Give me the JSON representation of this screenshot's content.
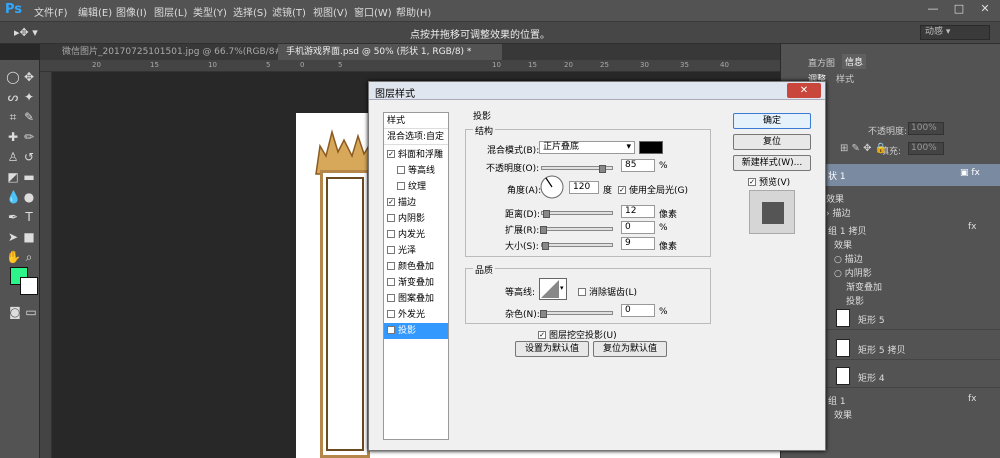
{
  "menubar": {
    "logo": "Ps",
    "items": [
      "文件(F)",
      "编辑(E)",
      "图像(I)",
      "图层(L)",
      "类型(Y)",
      "选择(S)",
      "滤镜(T)",
      "视图(V)",
      "窗口(W)",
      "帮助(H)"
    ]
  },
  "optionsbar": {
    "hint": "点按并拖移可调整效果的位置。",
    "workspace": "动感"
  },
  "tabs": [
    {
      "label": "微信图片_20170725101501.jpg @ 66.7%(RGB/8#) *"
    },
    {
      "label": "手机游戏界面.psd @ 50% (形状 1, RGB/8) *"
    }
  ],
  "ruler": {
    "labels": [
      "20",
      "15",
      "10",
      "5",
      "0",
      "5",
      "10",
      "15",
      "20",
      "25",
      "30",
      "35",
      "40"
    ]
  },
  "right_panel": {
    "tabs": [
      "直方图",
      "信息"
    ],
    "tab2": [
      "调整",
      "样式"
    ],
    "opacity_label": "不透明度:",
    "opacity_value": "100%",
    "fill_label": "填充:",
    "fill_value": "100%",
    "layers": [
      {
        "name": "状 1"
      },
      {
        "name": "效果"
      },
      {
        "name": "描边"
      },
      {
        "name": "组 1 拷贝"
      },
      {
        "name": "效果"
      },
      {
        "name": "描边"
      },
      {
        "name": "内阴影"
      },
      {
        "name": "渐变叠加"
      },
      {
        "name": "投影"
      },
      {
        "name": "矩形 5"
      },
      {
        "name": "矩形 5 拷贝"
      },
      {
        "name": "矩形 4"
      },
      {
        "name": "组 1"
      },
      {
        "name": "效果"
      }
    ]
  },
  "dialog": {
    "title": "图层样式",
    "close": "✕",
    "styles_header": "样式",
    "blend_options": "混合选项:自定",
    "styles": [
      {
        "label": "斜面和浮雕",
        "checked": true
      },
      {
        "label": "等高线",
        "checked": false
      },
      {
        "label": "纹理",
        "checked": false
      },
      {
        "label": "描边",
        "checked": true
      },
      {
        "label": "内阴影",
        "checked": false
      },
      {
        "label": "内发光",
        "checked": false
      },
      {
        "label": "光泽",
        "checked": false
      },
      {
        "label": "颜色叠加",
        "checked": false
      },
      {
        "label": "渐变叠加",
        "checked": false
      },
      {
        "label": "图案叠加",
        "checked": false
      },
      {
        "label": "外发光",
        "checked": false
      },
      {
        "label": "投影",
        "checked": true
      }
    ],
    "section_title": "投影",
    "structure_title": "结构",
    "blend_mode_label": "混合模式(B):",
    "blend_mode_value": "正片叠底",
    "opacity_label": "不透明度(O):",
    "opacity_value": "85",
    "opacity_level": 0.85,
    "angle_label": "角度(A):",
    "angle_value": "120",
    "angle_unit": "度",
    "global_light": "使用全局光(G)",
    "distance_label": "距离(D):",
    "distance_value": "12",
    "spread_label": "扩展(R):",
    "spread_value": "0",
    "size_label": "大小(S):",
    "size_value": "9",
    "unit_px": "像素",
    "unit_pct": "%",
    "quality_title": "品质",
    "contour_label": "等高线:",
    "antialias": "消除锯齿(L)",
    "noise_label": "杂色(N):",
    "noise_value": "0",
    "knockout": "图层挖空投影(U)",
    "set_default": "设置为默认值",
    "reset_default": "复位为默认值",
    "ok": "确定",
    "reset": "复位",
    "new_style": "新建样式(W)...",
    "preview": "预览(V)"
  }
}
